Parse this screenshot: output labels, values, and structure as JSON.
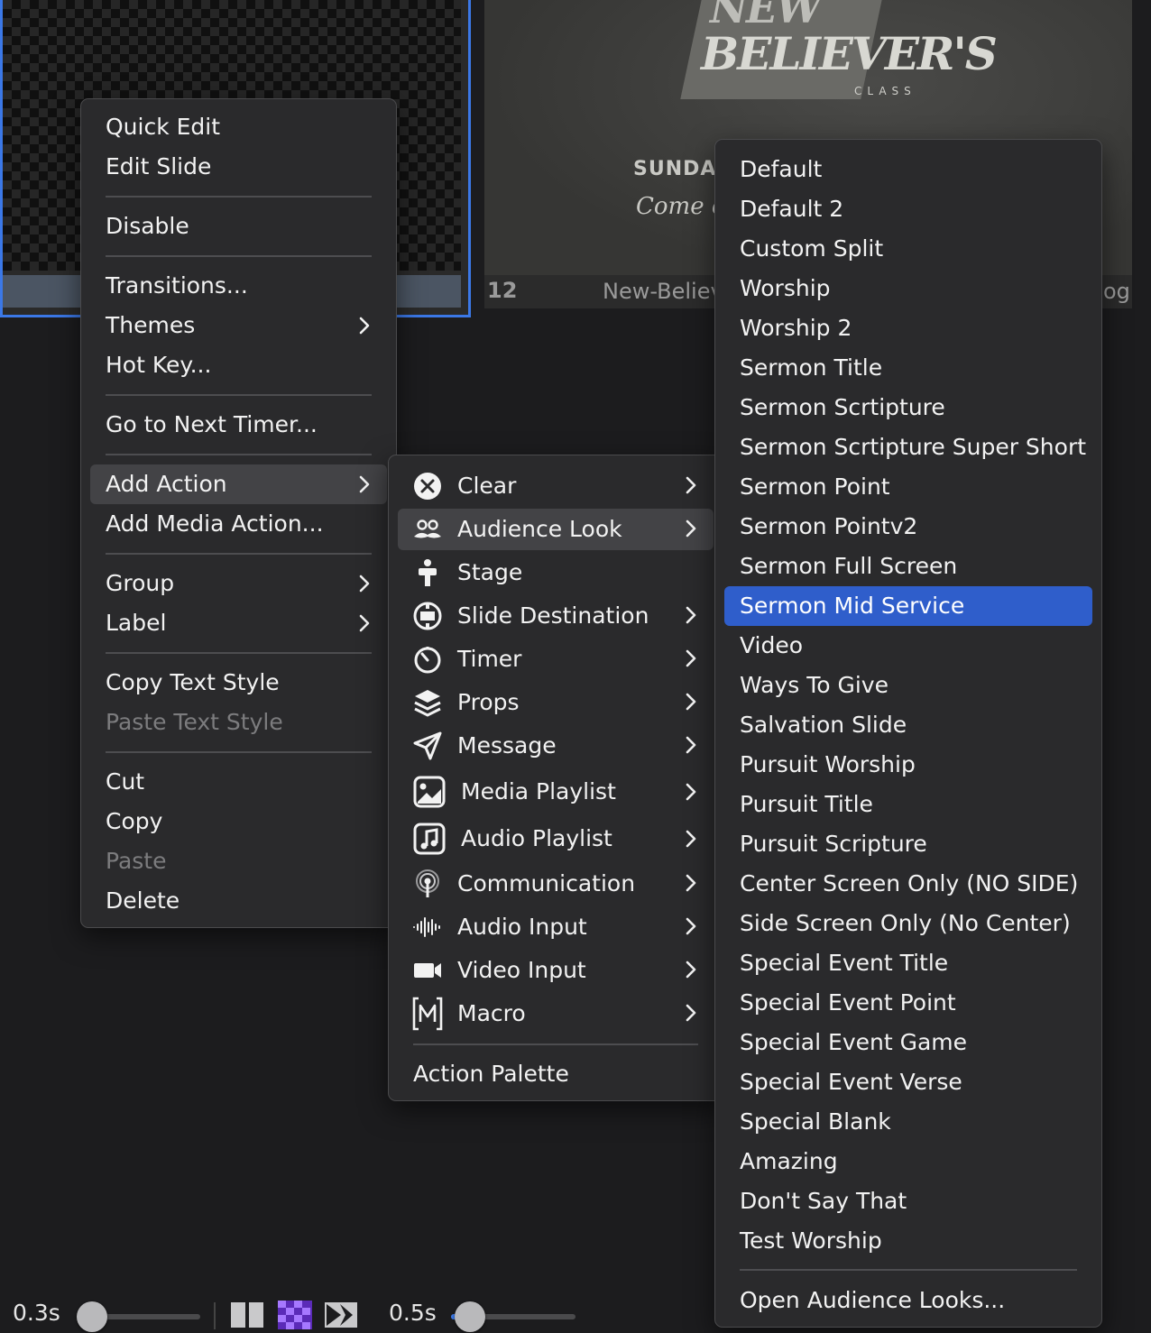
{
  "background": {
    "slide_right": {
      "title_line1": "NEW",
      "title_line2": "BELIEVER'S",
      "title_line3": "CLASS",
      "subtitle": "SUNDAYS",
      "tagline": "Come ea",
      "number": "12",
      "filename": "New-Believ",
      "filename_ext": "og"
    }
  },
  "context_menu": {
    "items": {
      "quick_edit": "Quick Edit",
      "edit_slide": "Edit Slide",
      "disable": "Disable",
      "transitions": "Transitions...",
      "themes": "Themes",
      "hot_key": "Hot Key...",
      "go_next_timer": "Go to Next Timer...",
      "add_action": "Add Action",
      "add_media_action": "Add Media Action...",
      "group": "Group",
      "label": "Label",
      "copy_text_style": "Copy Text Style",
      "paste_text_style": "Paste Text Style",
      "cut": "Cut",
      "copy": "Copy",
      "paste": "Paste",
      "delete": "Delete"
    }
  },
  "action_menu": {
    "items": {
      "clear": "Clear",
      "audience_look": "Audience Look",
      "stage": "Stage",
      "slide_destination": "Slide Destination",
      "timer": "Timer",
      "props": "Props",
      "message": "Message",
      "media_playlist": "Media Playlist",
      "audio_playlist": "Audio Playlist",
      "communication": "Communication",
      "audio_input": "Audio Input",
      "video_input": "Video Input",
      "macro": "Macro",
      "action_palette": "Action Palette"
    }
  },
  "looks_menu": {
    "items": [
      "Default",
      "Default 2",
      "Custom Split",
      "Worship",
      "Worship 2",
      "Sermon Title",
      "Sermon Scrtipture",
      "Sermon Scrtipture Super Short",
      "Sermon Point",
      "Sermon Pointv2",
      "Sermon Full Screen",
      "Sermon Mid Service",
      "Video",
      "Ways To Give",
      "Salvation Slide",
      "Pursuit Worship",
      "Pursuit Title",
      "Pursuit Scripture",
      "Center Screen Only (NO SIDE)",
      "Side Screen Only (No Center)",
      "Special Event Title",
      "Special Event Point",
      "Special Event Game",
      "Special Event Verse",
      "Special Blank",
      "Amazing",
      "Don't Say That",
      "Test Worship"
    ],
    "selected": "Sermon Mid Service",
    "open_looks": "Open Audience Looks..."
  },
  "bottom_bar": {
    "transition_time_1": "0.3s",
    "slider_1_value": 0.12,
    "transition_time_2": "0.5s",
    "slider_2_value": 0.15
  },
  "colors": {
    "selection": "#2f5ecb",
    "accent": "#3b78e7",
    "menu_bg": "#2a2a2c",
    "transition_icon_purple": "#8a4cf0"
  }
}
